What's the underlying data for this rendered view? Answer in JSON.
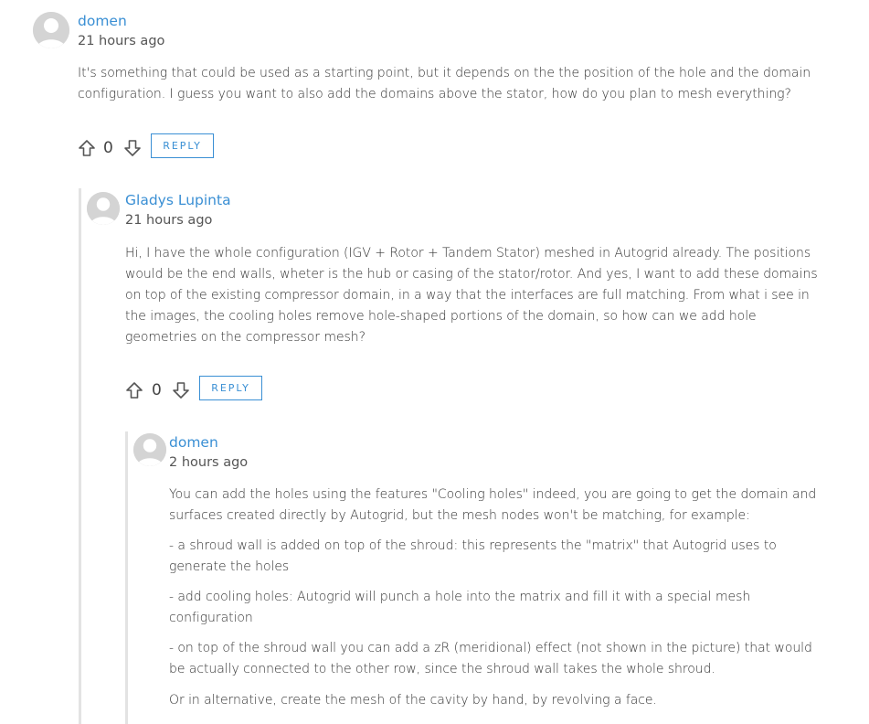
{
  "comments": [
    {
      "author": "domen",
      "time": "21 hours ago",
      "paragraphs": [
        "It's something that could be used as a starting point, but it depends on the the position of the hole and the domain configuration. I guess you want to also add the domains above the stator, how do you plan to mesh everything?"
      ],
      "votes": "0",
      "reply_label": "REPLY"
    },
    {
      "author": "Gladys Lupinta",
      "time": "21 hours ago",
      "paragraphs": [
        "Hi, I have the whole configuration (IGV + Rotor + Tandem Stator) meshed in Autogrid already. The positions would be the end walls, wheter is the hub or casing of the stator/rotor. And yes, I want to add these domains on top of the existing compressor domain, in a way that the interfaces are full matching. From what i see in the images, the cooling holes remove hole-shaped portions of the domain, so how can we add hole geometries on the compressor mesh?"
      ],
      "votes": "0",
      "reply_label": "REPLY"
    },
    {
      "author": "domen",
      "time": "2 hours ago",
      "paragraphs": [
        "You can add the holes using the features \"Cooling holes\" indeed, you are going to get the domain and surfaces created directly by Autogrid, but the mesh nodes won't be matching, for example:",
        "- a shroud wall is added on top of the shroud: this represents the \"matrix\" that Autogrid uses to generate the holes",
        "- add cooling holes: Autogrid will punch a hole into the matrix and fill it with a special mesh configuration",
        "- on top of the shroud wall you can add a zR (meridional) effect (not shown in the picture) that would be actually connected to the other row, since the shroud wall takes the whole shroud.",
        "Or in alternative, create the mesh of the cavity by hand, by revolving a face."
      ]
    }
  ],
  "icons": {
    "avatar": "user-avatar-icon",
    "upvote": "arrow-up-outline-icon",
    "downvote": "arrow-down-outline-icon"
  },
  "colors": {
    "link": "#3a8fd4",
    "text": "#333333",
    "muted": "#555555",
    "thread_line": "#e3e3e3",
    "avatar_bg": "#d4d4d4"
  }
}
